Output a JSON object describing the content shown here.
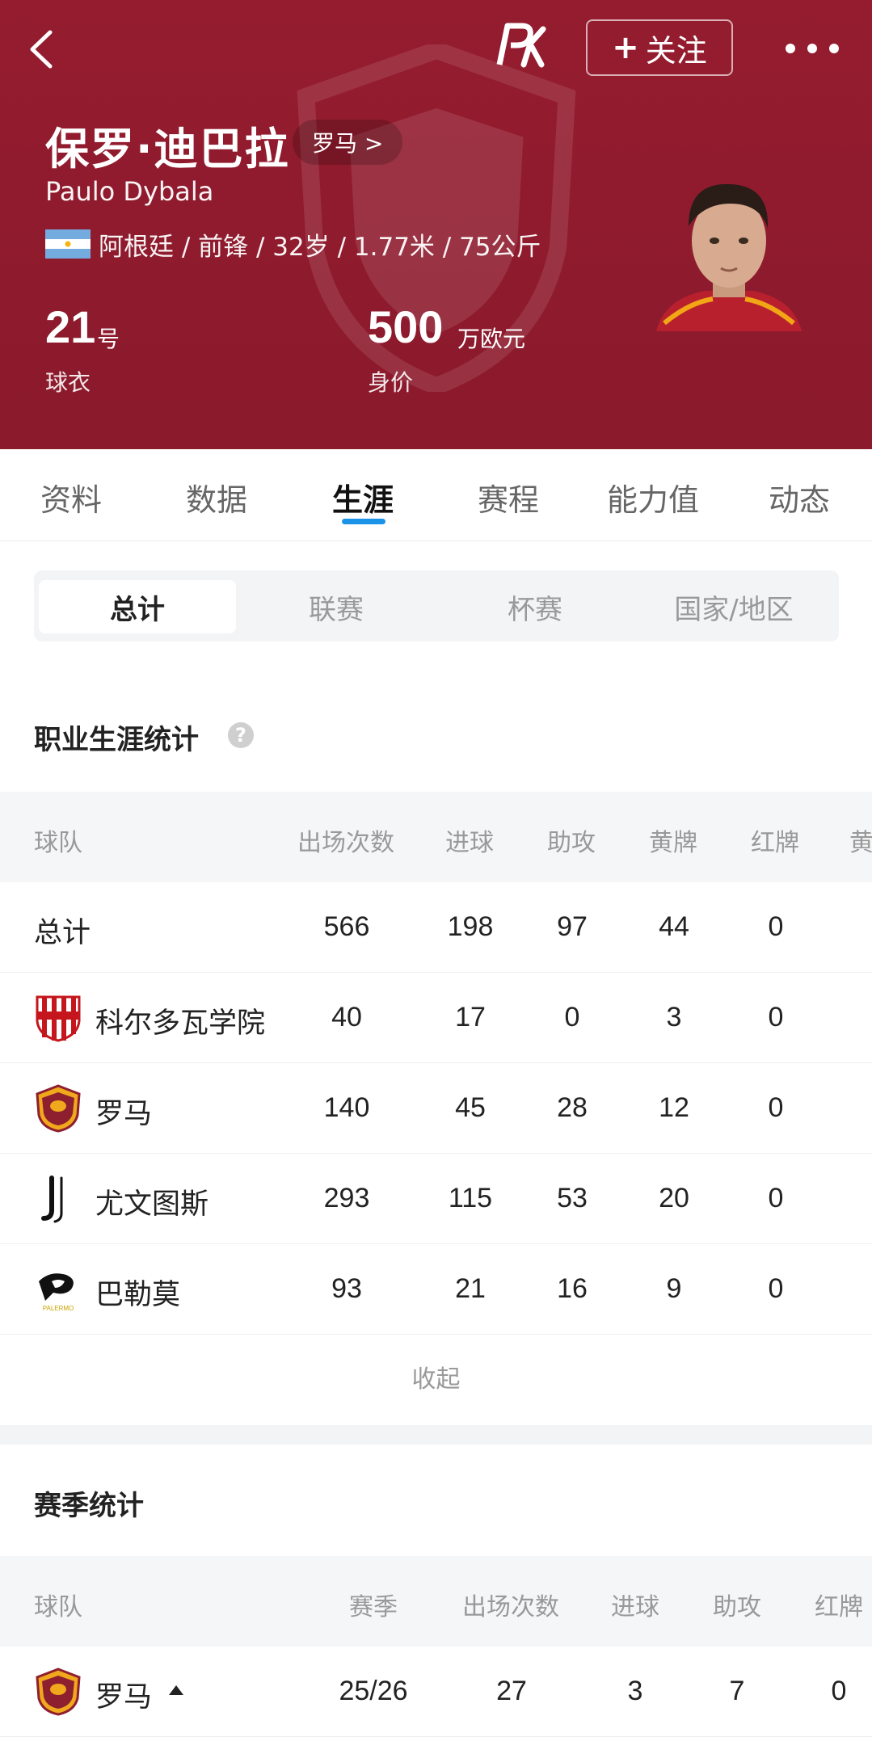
{
  "header": {
    "follow_label": "关注",
    "name_cn": "保罗·迪巴拉",
    "name_en": "Paulo Dybala",
    "team_chip": "罗马 >",
    "bio": "阿根廷 / 前锋 / 32岁 / 1.77米 / 75公斤",
    "shirt_number": "21",
    "shirt_unit": "号",
    "shirt_label": "球衣",
    "value_number": "500",
    "value_unit": "万欧元",
    "value_label": "身价",
    "brand_color": "#951c2f"
  },
  "tabs": [
    "资料",
    "数据",
    "生涯",
    "赛程",
    "能力值",
    "动态"
  ],
  "active_tab": "生涯",
  "segments": [
    "总计",
    "联赛",
    "杯赛",
    "国家/地区"
  ],
  "career": {
    "title": "职业生涯统计",
    "columns": [
      "球队",
      "出场次数",
      "进球",
      "助攻",
      "黄牌",
      "红牌",
      "黄"
    ],
    "total_row": {
      "team": "总计",
      "apps": "566",
      "goals": "198",
      "assists": "97",
      "yellow": "44",
      "red": "0"
    },
    "rows": [
      {
        "team": "科尔多瓦学院",
        "apps": "40",
        "goals": "17",
        "assists": "0",
        "yellow": "3",
        "red": "0",
        "logo": "instituto-crest"
      },
      {
        "team": "罗马",
        "apps": "140",
        "goals": "45",
        "assists": "28",
        "yellow": "12",
        "red": "0",
        "logo": "roma-crest"
      },
      {
        "team": "尤文图斯",
        "apps": "293",
        "goals": "115",
        "assists": "53",
        "yellow": "20",
        "red": "0",
        "logo": "juventus-crest"
      },
      {
        "team": "巴勒莫",
        "apps": "93",
        "goals": "21",
        "assists": "16",
        "yellow": "9",
        "red": "0",
        "logo": "palermo-crest",
        "logo_text": "PALERMO"
      }
    ],
    "collapse_label": "收起"
  },
  "season": {
    "title": "赛季统计",
    "columns": [
      "球队",
      "赛季",
      "出场次数",
      "进球",
      "助攻",
      "红牌"
    ],
    "rows": [
      {
        "team": "罗马",
        "season": "25/26",
        "apps": "27",
        "goals": "3",
        "assists": "7",
        "red": "0",
        "logo": "roma-crest"
      }
    ]
  }
}
